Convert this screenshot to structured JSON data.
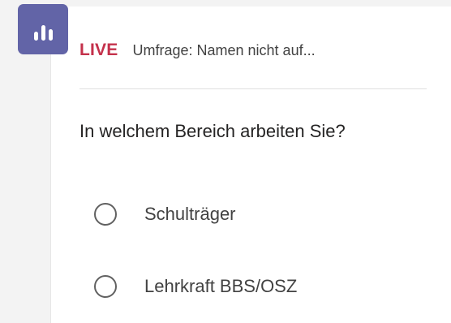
{
  "app": {
    "icon": "poll-chart-icon",
    "accent_color": "#6264a7"
  },
  "poll": {
    "status": "LIVE",
    "status_color": "#c4314b",
    "title": "Umfrage: Namen nicht auf...",
    "question": "In welchem Bereich arbeiten Sie?",
    "options": [
      {
        "label": "Schulträger"
      },
      {
        "label": "Lehrkraft BBS/OSZ"
      }
    ]
  }
}
